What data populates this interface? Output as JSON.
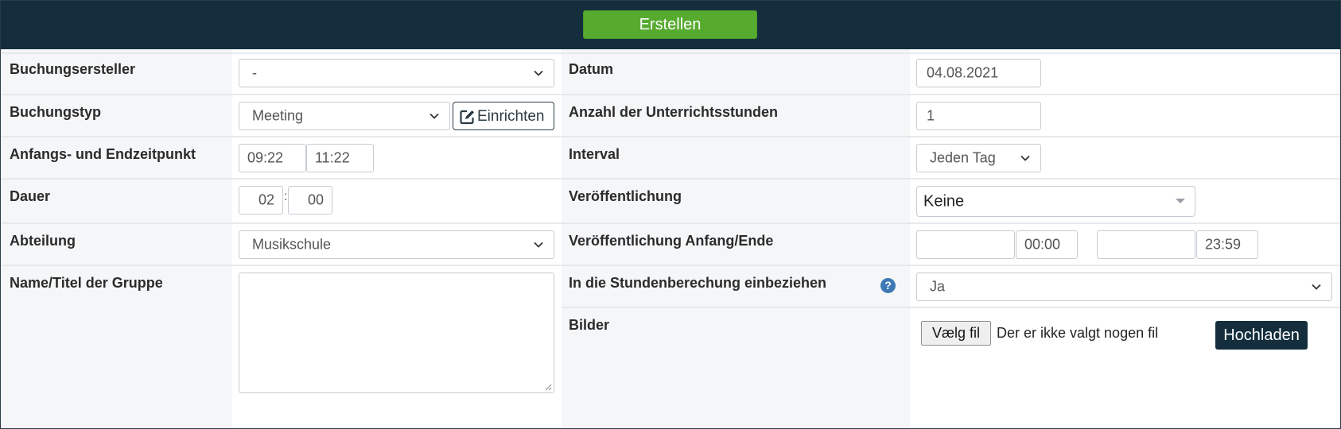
{
  "header": {
    "create_label": "Erstellen"
  },
  "left": {
    "booking_creator": {
      "label": "Buchungsersteller",
      "value": "-"
    },
    "booking_type": {
      "label": "Buchungstyp",
      "value": "Meeting",
      "setup_label": "Einrichten"
    },
    "start_end": {
      "label": "Anfangs- und Endzeitpunkt",
      "start": "09:22",
      "end": "11:22"
    },
    "duration": {
      "label": "Dauer",
      "hours": "02",
      "separator": ":",
      "minutes": "00"
    },
    "department": {
      "label": "Abteilung",
      "value": "Musikschule"
    },
    "group_name": {
      "label": "Name/Titel der Gruppe",
      "value": ""
    }
  },
  "right": {
    "date": {
      "label": "Datum",
      "value": "04.08.2021"
    },
    "lessons": {
      "label": "Anzahl der Unterrichtsstunden",
      "value": "1"
    },
    "interval": {
      "label": "Interval",
      "value": "Jeden Tag"
    },
    "publication": {
      "label": "Veröffentlichung",
      "value": "Keine"
    },
    "publication_range": {
      "label": "Veröffentlichung Anfang/Ende",
      "start_date": "",
      "start_time": "00:00",
      "end_date": "",
      "end_time": "23:59"
    },
    "include_hours": {
      "label": "In die Stundenberechung einbeziehen",
      "value": "Ja",
      "help_icon": "question-circle-icon"
    },
    "images": {
      "label": "Bilder",
      "choose_file_label": "Vælg fil",
      "file_status": "Der er ikke valgt nogen fil",
      "upload_label": "Hochladen"
    }
  },
  "colors": {
    "header_bg": "#142e3e",
    "create_button": "#56ab2f",
    "label_column_bg": "#f4f6f8",
    "help_icon": "#3e78b5"
  }
}
